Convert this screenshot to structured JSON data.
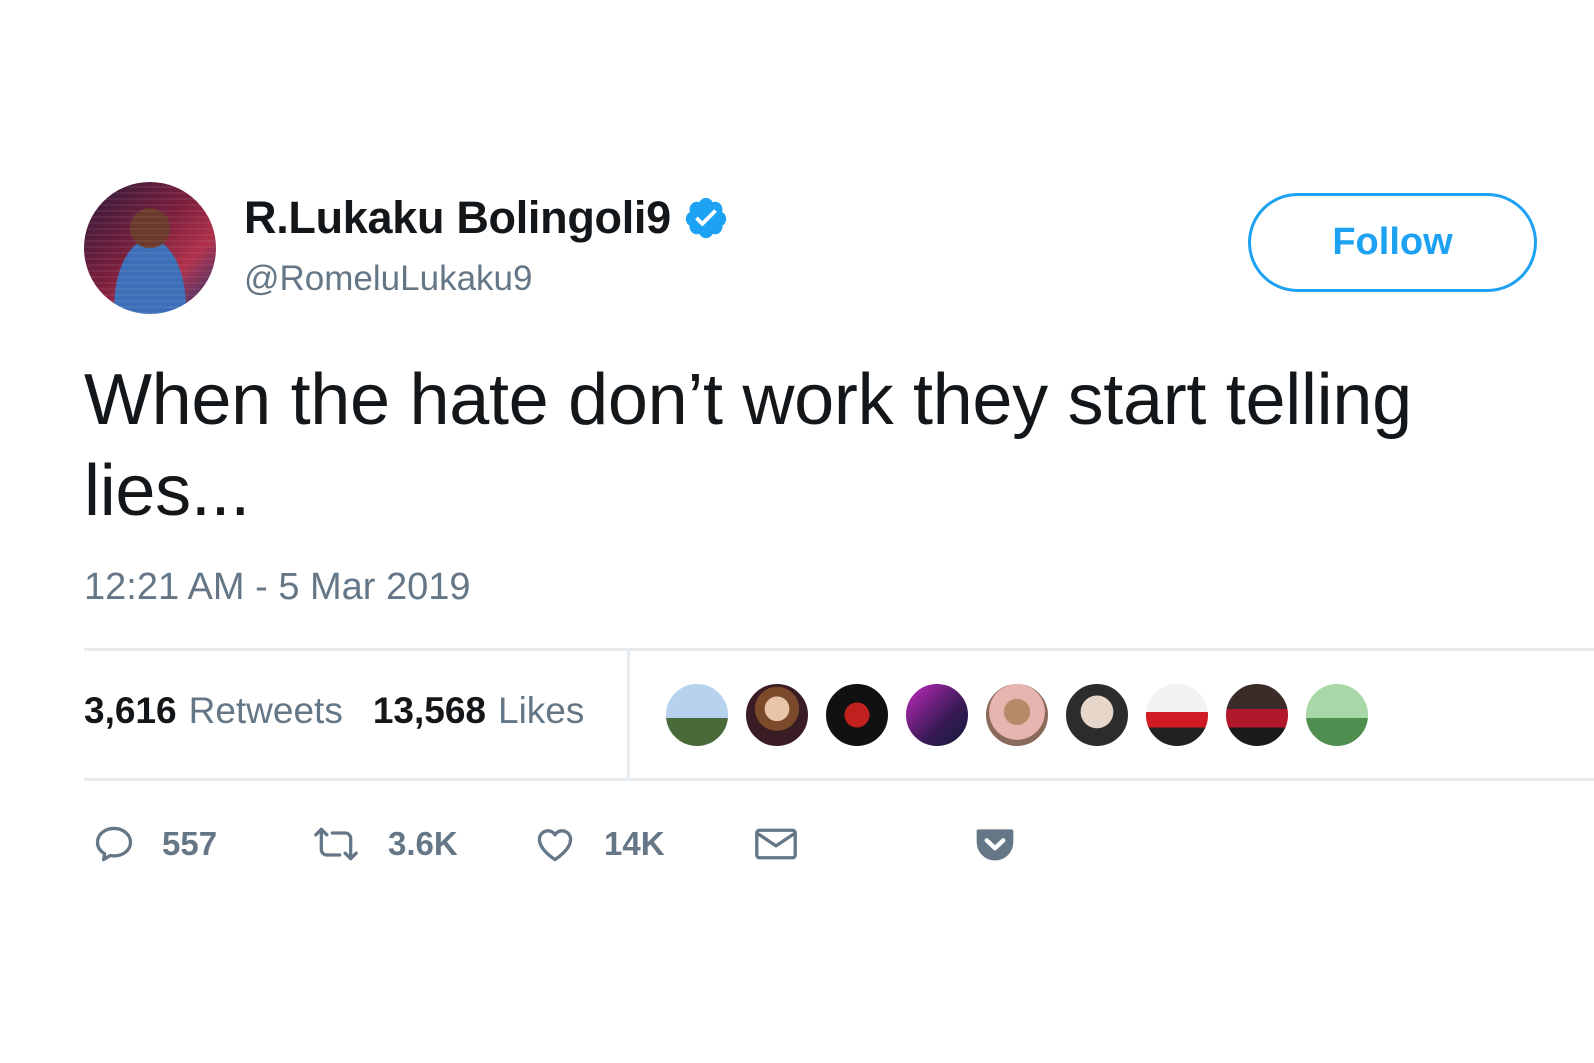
{
  "user": {
    "display_name": "R.Lukaku Bolingoli9",
    "handle": "@RomeluLukaku9",
    "verified": true
  },
  "follow_button": {
    "label": "Follow"
  },
  "tweet": {
    "text": "When the hate don’t work they start telling lies...",
    "timestamp": "12:21 AM - 5 Mar 2019"
  },
  "stats": {
    "retweets_count": "3,616",
    "retweets_label": "Retweets",
    "likes_count": "13,568",
    "likes_label": "Likes"
  },
  "likers_avatars_count": 9,
  "actions": {
    "reply_count": "557",
    "retweet_count": "3.6K",
    "like_count": "14K"
  },
  "colors": {
    "accent": "#1da1f2",
    "text": "#14171a",
    "secondary_text": "#657786",
    "divider": "#e6ecf0"
  },
  "icons": [
    "verified-badge-icon",
    "reply-icon",
    "retweet-icon",
    "heart-icon",
    "mail-icon",
    "pocket-icon"
  ]
}
